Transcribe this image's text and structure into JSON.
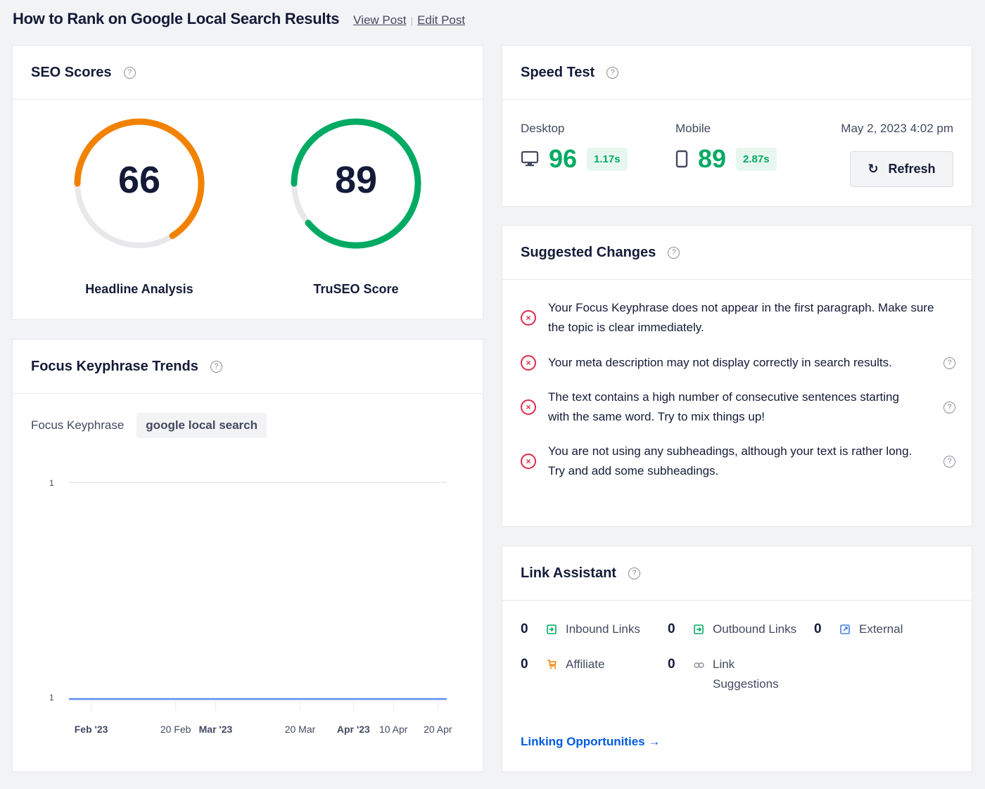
{
  "header": {
    "title": "How to Rank on Google Local Search Results",
    "view_post": "View Post",
    "separator": "|",
    "edit_post": "Edit Post"
  },
  "seo_scores": {
    "title": "SEO Scores",
    "help": "?",
    "gauges": [
      {
        "label": "Headline Analysis",
        "value": "66",
        "percent": 66,
        "color": "#f18200"
      },
      {
        "label": "TruSEO Score",
        "value": "89",
        "percent": 89,
        "color": "#00aa63"
      }
    ],
    "track_color": "#e8e8eb"
  },
  "trends": {
    "title": "Focus Keyphrase Trends",
    "help": "?",
    "keyphrase_label": "Focus Keyphrase",
    "keyphrase_value": "google local search"
  },
  "chart_data": {
    "type": "line",
    "title": "",
    "xlabel": "",
    "ylabel": "",
    "y_tick_labels": [
      "1",
      "1"
    ],
    "x_tick_labels": [
      {
        "label": "Feb '23",
        "bold": true
      },
      {
        "label": "20 Feb",
        "bold": false
      },
      {
        "label": "Mar '23",
        "bold": true
      },
      {
        "label": "20 Mar",
        "bold": false
      },
      {
        "label": "Apr '23",
        "bold": true
      },
      {
        "label": "10 Apr",
        "bold": false
      },
      {
        "label": "20 Apr",
        "bold": false
      }
    ],
    "x_range": [
      "2023-01-27",
      "2023-04-22"
    ],
    "x_ticks": [
      "2023-02-01",
      "2023-02-20",
      "2023-03-01",
      "2023-03-20",
      "2023-04-01",
      "2023-04-10",
      "2023-04-20"
    ],
    "series": [
      {
        "name": "google local search",
        "color": "#5b8def",
        "points": [
          [
            "2023-01-27",
            1
          ],
          [
            "2023-04-22",
            1
          ]
        ]
      }
    ],
    "grid": true
  },
  "speed_test": {
    "title": "Speed Test",
    "help": "?",
    "desktop": {
      "label": "Desktop",
      "score": "96",
      "time": "1.17s",
      "icon": "desktop-icon"
    },
    "mobile": {
      "label": "Mobile",
      "score": "89",
      "time": "2.87s",
      "icon": "mobile-icon"
    },
    "date": "May 2, 2023 4:02 pm",
    "refresh_label": "Refresh",
    "refresh_icon": "↻"
  },
  "suggested_changes": {
    "title": "Suggested Changes",
    "help": "?",
    "items": [
      {
        "text": "Your Focus Keyphrase does not appear in the first paragraph. Make sure the topic is clear immediately.",
        "has_help": false
      },
      {
        "text": "Your meta description may not display correctly in search results.",
        "has_help": true
      },
      {
        "text": "The text contains a high number of consecutive sentences starting with the same word. Try to mix things up!",
        "has_help": true
      },
      {
        "text": "You are not using any subheadings, although your text is rather long. Try and add some subheadings.",
        "has_help": true
      }
    ],
    "error_icon": "×"
  },
  "link_assistant": {
    "title": "Link Assistant",
    "help": "?",
    "stats": [
      {
        "count": "0",
        "label": "Inbound Links",
        "icon": "inbound-link-icon",
        "color": "#00aa63"
      },
      {
        "count": "0",
        "label": "Outbound Links",
        "icon": "outbound-link-icon",
        "color": "#00aa63"
      },
      {
        "count": "0",
        "label": "External",
        "icon": "external-link-icon",
        "color": "#447fe1"
      },
      {
        "count": "0",
        "label": "Affiliate",
        "icon": "cart-icon",
        "color": "#f18200"
      },
      {
        "count": "0",
        "label": "Link Suggestions",
        "icon": "chain-link-icon",
        "color": "#8c8f9a"
      }
    ],
    "linking_opportunities": "Linking Opportunities →"
  }
}
